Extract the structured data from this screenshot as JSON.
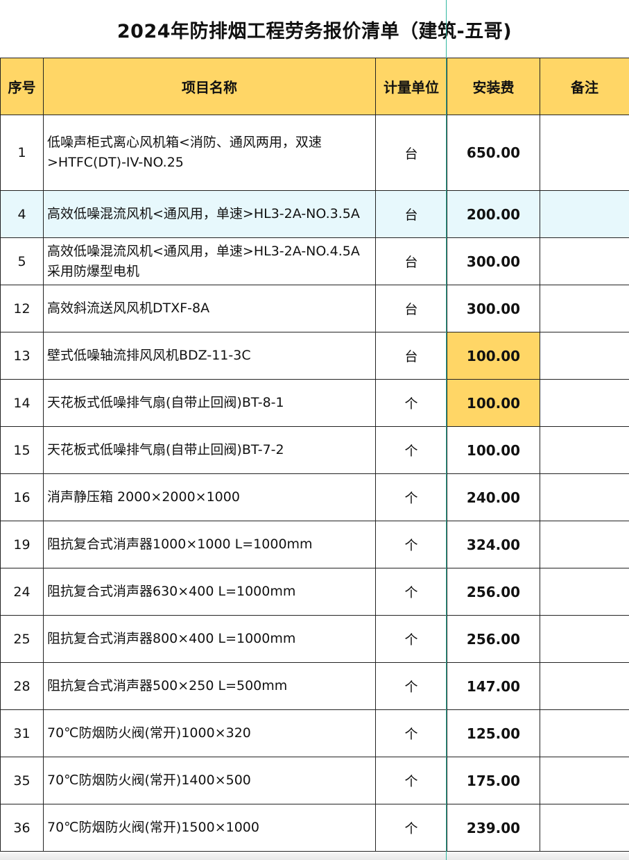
{
  "title": "2024年防排烟工程劳务报价清单（建筑-五哥)",
  "headers": {
    "index": "序号",
    "name": "项目名称",
    "unit": "计量单位",
    "fee": "安装费",
    "note": "备注"
  },
  "rows": [
    {
      "index": "1",
      "name": "低噪声柜式离心风机箱<消防、通风两用，双速>HTFC(DT)-IV-NO.25",
      "unit": "台",
      "fee": "650.00",
      "note": ""
    },
    {
      "index": "4",
      "name": "高效低噪混流风机<通风用，单速>HL3-2A-NO.3.5A",
      "unit": "台",
      "fee": "200.00",
      "note": ""
    },
    {
      "index": "5",
      "name": "高效低噪混流风机<通风用，单速>HL3-2A-NO.4.5A采用防爆型电机",
      "unit": "台",
      "fee": "300.00",
      "note": ""
    },
    {
      "index": "12",
      "name": "高效斜流送风风机DTXF-8A",
      "unit": "台",
      "fee": "300.00",
      "note": ""
    },
    {
      "index": "13",
      "name": "壁式低噪轴流排风风机BDZ-11-3C",
      "unit": "台",
      "fee": "100.00",
      "note": ""
    },
    {
      "index": "14",
      "name": "天花板式低噪排气扇(自带止回阀)BT-8-1",
      "unit": "个",
      "fee": "100.00",
      "note": ""
    },
    {
      "index": "15",
      "name": "天花板式低噪排气扇(自带止回阀)BT-7-2",
      "unit": "个",
      "fee": "100.00",
      "note": ""
    },
    {
      "index": "16",
      "name": "消声静压箱 2000×2000×1000",
      "unit": "个",
      "fee": "240.00",
      "note": ""
    },
    {
      "index": "19",
      "name": "阻抗复合式消声器1000×1000 L=1000mm",
      "unit": "个",
      "fee": "324.00",
      "note": ""
    },
    {
      "index": "24",
      "name": "阻抗复合式消声器630×400 L=1000mm",
      "unit": "个",
      "fee": "256.00",
      "note": ""
    },
    {
      "index": "25",
      "name": "阻抗复合式消声器800×400 L=1000mm",
      "unit": "个",
      "fee": "256.00",
      "note": ""
    },
    {
      "index": "28",
      "name": "阻抗复合式消声器500×250 L=500mm",
      "unit": "个",
      "fee": "147.00",
      "note": ""
    },
    {
      "index": "31",
      "name": "70℃防烟防火阀(常开)1000×320",
      "unit": "个",
      "fee": "125.00",
      "note": ""
    },
    {
      "index": "35",
      "name": "70℃防烟防火阀(常开)1400×500",
      "unit": "个",
      "fee": "175.00",
      "note": ""
    },
    {
      "index": "36",
      "name": "70℃防烟防火阀(常开)1500×1000",
      "unit": "个",
      "fee": "239.00",
      "note": ""
    }
  ],
  "colors": {
    "header_fill": "#ffd666",
    "selected_row_fill": "#e7f8fc",
    "highlight_cell_fill": "#ffd666",
    "guide_line": "#2fb8a0"
  }
}
